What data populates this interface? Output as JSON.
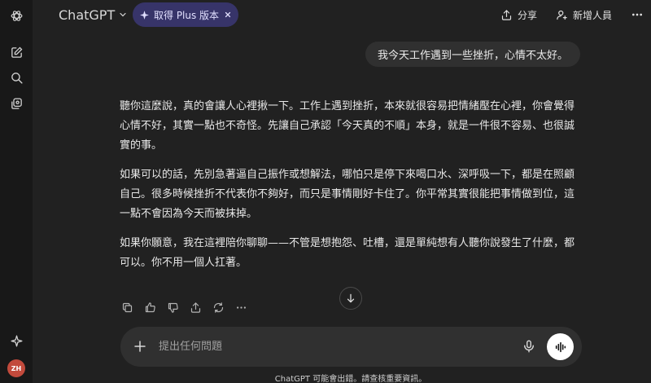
{
  "header": {
    "model_name": "ChatGPT",
    "plus_badge": "取得 Plus 版本",
    "share_label": "分享",
    "add_member_label": "新增人員"
  },
  "user_message": "我今天工作遇到一些挫折，心情不太好。",
  "assistant_reply": {
    "paragraphs": [
      "聽你這麼說，真的會讓人心裡揪一下。工作上遇到挫折，本來就很容易把情緒壓在心裡，你會覺得心情不好，其實一點也不奇怪。先讓自己承認「今天真的不順」本身，就是一件很不容易、也很誠實的事。",
      "如果可以的話，先別急著逼自己振作或想解法，哪怕只是停下來喝口水、深呼吸一下，都是在照顧自己。很多時候挫折不代表你不夠好，而只是事情剛好卡住了。你平常其實很能把事情做到位，這一點不會因為今天而被抹掉。",
      "如果你願意，我在這裡陪你聊聊——不管是想抱怨、吐槽，還是單純想有人聽你說發生了什麼，都可以。你不用一個人扛著。"
    ]
  },
  "composer": {
    "placeholder": "提出任何問題"
  },
  "footer": {
    "disclaimer": "ChatGPT 可能會出錯。請查核重要資訊。"
  },
  "avatar_initials": "ZH",
  "colors": {
    "background": "#212121",
    "sidebar": "#181818",
    "bubble": "#303030",
    "plus_pill": "#373469",
    "avatar": "#c24a3c"
  },
  "icons": {
    "rail": [
      "openai-logo-icon",
      "new-chat-icon",
      "search-icon",
      "library-icon",
      "sparkle-icon"
    ],
    "actions": [
      "copy-icon",
      "thumbs-up-icon",
      "thumbs-down-icon",
      "share-icon",
      "regenerate-icon",
      "more-icon"
    ]
  }
}
